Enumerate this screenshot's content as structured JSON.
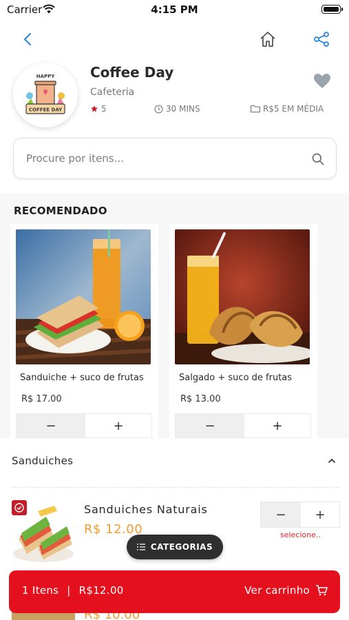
{
  "status_bar": {
    "carrier": "Carrier",
    "time": "4:15 PM"
  },
  "nav": {
    "back_icon": "chevron-left-icon",
    "home_icon": "home-icon",
    "share_icon": "share-icon"
  },
  "store": {
    "name": "Coffee Day",
    "type": "Cafeteria",
    "rating": "5",
    "delivery_time": "30 MINS",
    "avg_price": "R$5 EM MÉDIA",
    "logo_top_text": "HAPPY",
    "logo_bottom_text": "COFFEE DAY"
  },
  "search": {
    "placeholder": "Procure por itens..."
  },
  "recommended": {
    "title": "RECOMENDADO",
    "items": [
      {
        "name": "Sanduiche + suco de frutas",
        "price": "R$ 17.00"
      },
      {
        "name": "Salgado + suco de frutas",
        "price": "R$ 13.00"
      }
    ],
    "minus_label": "−",
    "plus_label": "+"
  },
  "category": {
    "label": "Sanduiches",
    "products": [
      {
        "name": "Sanduiches Naturais",
        "price": "R$ 12.00",
        "select_label": "selecione..",
        "minus_label": "−",
        "plus_label": "+"
      }
    ],
    "next_price": "R$ 10.00"
  },
  "categories_button": {
    "label": "CATEGORIAS"
  },
  "cart": {
    "items": "1 Itens",
    "separator": "|",
    "total": "R$12.00",
    "action": "Ver carrinho"
  },
  "colors": {
    "accent_red": "#e4101e",
    "price_orange": "#f39b2e",
    "link_blue": "#2b86d9"
  }
}
